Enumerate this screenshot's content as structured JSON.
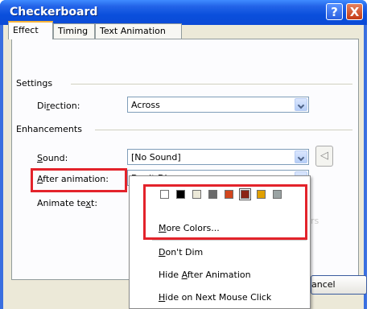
{
  "window": {
    "title": "Checkerboard",
    "help": "?",
    "close": "X"
  },
  "tabs": [
    "Effect",
    "Timing",
    "Text Animation"
  ],
  "settings": {
    "group": "Settings",
    "direction_prefix": "Di",
    "direction_key": "r",
    "direction_suffix": "ection:",
    "direction_value": "Across"
  },
  "enhancements": {
    "group": "Enhancements",
    "sound_key": "S",
    "sound_suffix": "ound:",
    "sound_value": "[No Sound]",
    "after_key": "A",
    "after_suffix": "fter animation:",
    "after_value": "Don't Dim",
    "animate_prefix": "Animate te",
    "animate_key": "x",
    "animate_suffix": "t:",
    "speaker_icon": "speaker-icon"
  },
  "popup": {
    "swatches": [
      "#ffffff",
      "#000000",
      "#ece9d8",
      "#6b6b6b",
      "#d2461e",
      "#8b2414",
      "#e0a000",
      "#9aa3a3"
    ],
    "selected_swatch": 5,
    "more_colors_key": "M",
    "more_colors_suffix": "ore Colors...",
    "dont_dim_key": "D",
    "dont_dim_suffix": "on't Dim",
    "hide_after_prefix": "Hide ",
    "hide_after_key": "A",
    "hide_after_suffix": "fter Animation",
    "hide_click_key": "H",
    "hide_click_suffix": "ide on Next Mouse Click"
  },
  "overflow_text": "rs",
  "buttons": {
    "cancel_partial": "ancel"
  }
}
